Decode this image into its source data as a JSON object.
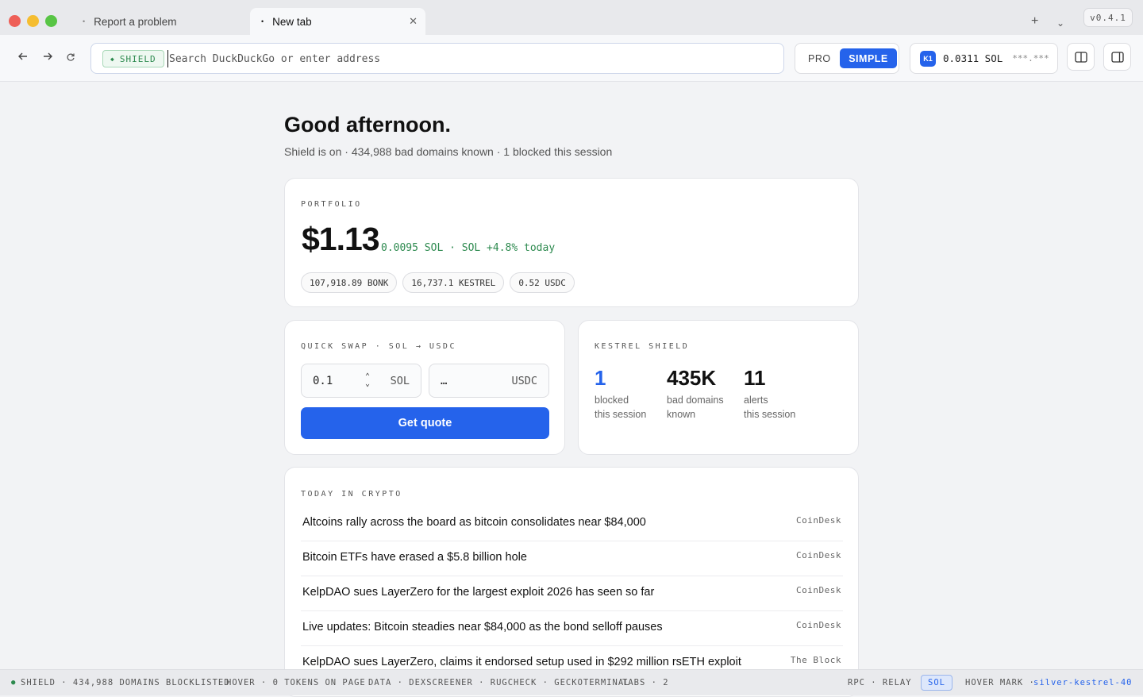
{
  "tabs": [
    {
      "label": "Report a problem"
    },
    {
      "label": "New tab"
    }
  ],
  "version": "v0.4.1",
  "toolbar": {
    "shield_label": "SHIELD",
    "url_placeholder": "Search DuckDuckGo or enter address",
    "mode_pro": "PRO",
    "mode_simple": "SIMPLE",
    "wallet_badge": "K1",
    "wallet_balance": "0.0311 SOL",
    "wallet_mask": "***.***"
  },
  "greeting": {
    "title": "Good afternoon.",
    "subtitle": "Shield is on · 434,988 bad domains known · 1 blocked this session"
  },
  "portfolio": {
    "label": "PORTFOLIO",
    "value": "$1.13",
    "detail": "0.0095 SOL · SOL +4.8% today",
    "holdings": [
      "107,918.89 BONK",
      "16,737.1 KESTREL",
      "0.52 USDC"
    ]
  },
  "swap": {
    "label": "QUICK SWAP · SOL → USDC",
    "from_amount": "0.1",
    "from_currency": "SOL",
    "to_amount": "…",
    "to_currency": "USDC",
    "button": "Get quote"
  },
  "shield": {
    "label": "KESTREL SHIELD",
    "stats": [
      {
        "value": "1",
        "line1": "blocked",
        "line2": "this session"
      },
      {
        "value": "435K",
        "line1": "bad domains",
        "line2": "known"
      },
      {
        "value": "11",
        "line1": "alerts",
        "line2": "this session"
      }
    ]
  },
  "news": {
    "label": "TODAY IN CRYPTO",
    "items": [
      {
        "headline": "Altcoins rally across the board as bitcoin consolidates near $84,000",
        "source": "CoinDesk"
      },
      {
        "headline": "Bitcoin ETFs have erased a $5.8 billion hole",
        "source": "CoinDesk"
      },
      {
        "headline": "KelpDAO sues LayerZero for the largest exploit 2026 has seen so far",
        "source": "CoinDesk"
      },
      {
        "headline": "Live updates: Bitcoin steadies near $84,000 as the bond selloff pauses",
        "source": "CoinDesk"
      },
      {
        "headline": "KelpDAO sues LayerZero, claims it endorsed setup used in $292 million rsETH exploit",
        "source": "The Block"
      }
    ]
  },
  "statusbar": {
    "shield": "SHIELD · 434,988 DOMAINS BLOCKLISTED",
    "hover": "HOVER · 0 TOKENS ON PAGE",
    "data": "DATA · DEXSCREENER · RUGCHECK · GECKOTERMINAL",
    "tabs": "TABS · 2",
    "rpc": "RPC · RELAY",
    "sol": "SOL",
    "hover_mark_label": "HOVER MARK ·",
    "hover_mark_value": "silver-kestrel-40"
  },
  "colors": {
    "accent": "#2563eb",
    "positive": "#2d8a4f",
    "traffic_red": "#ee5f57",
    "traffic_yellow": "#f5bd30",
    "traffic_green": "#58c545"
  }
}
